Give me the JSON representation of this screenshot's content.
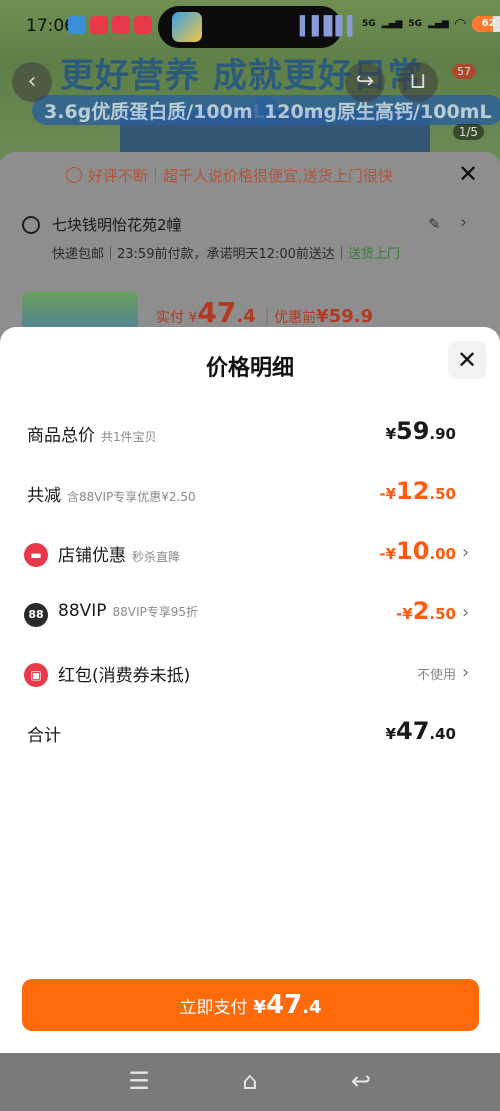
{
  "status_bar": {
    "time": "17:06",
    "signal_label_1": "5G",
    "signal_label_2": "5G",
    "battery": "62",
    "battery_level": 0.62
  },
  "background_page": {
    "banner_title": "更好营养 成就更好日常",
    "pill_1": "3.6g优质蛋白质/100mL",
    "pill_2": "120mg原生高钙/100mL",
    "image_counter": "1/5",
    "cart_badge": "57",
    "promo_text": "好评不断｜超千人说价格很便宜,送货上门很快",
    "address": "七块钱明怡花苑2幢",
    "shipping_prefix": "快递包邮｜23:59前付款，承诺明天12:00前送达｜",
    "shipping_highlight": "送货上门",
    "pay_prefix": "实付 ¥",
    "pay_int": "47",
    "pay_dec": ".4",
    "pay_sep": "｜优惠前",
    "pay_before": "¥59.9"
  },
  "sheet": {
    "title": "价格明细",
    "rows": [
      {
        "label": "商品总价",
        "sub": "共1件宝贝",
        "cur": "¥",
        "int": "59",
        "dec": ".90"
      },
      {
        "label": "共减",
        "sub": "含88VIP专享优惠¥2.50",
        "cur": "-¥",
        "int": "12",
        "dec": ".50"
      },
      {
        "label": "店铺优惠",
        "sub": "秒杀直降",
        "cur": "-¥",
        "int": "10",
        "dec": ".00"
      },
      {
        "label": "88VIP",
        "sub": "88VIP专享95折",
        "cur": "-¥",
        "int": "2",
        "dec": ".50",
        "icon_text": "88"
      },
      {
        "label": "红包(消费券未抵)",
        "value_text": "不使用"
      },
      {
        "label": "合计",
        "cur": "¥",
        "int": "47",
        "dec": ".40"
      }
    ],
    "pay_button": {
      "label": "立即支付",
      "cur": "¥",
      "int": "47",
      "dec": ".4"
    }
  },
  "colors": {
    "accent_orange": "#ff6a0a",
    "discount_orange": "#ff5a10",
    "shop_red": "#e8394a"
  },
  "icons": [
    "location-icon",
    "edit-icon",
    "close-icon",
    "shop-coupon-icon",
    "vip-88-icon",
    "red-packet-icon",
    "chevron-right-icon",
    "menu-icon",
    "home-icon",
    "back-icon"
  ]
}
